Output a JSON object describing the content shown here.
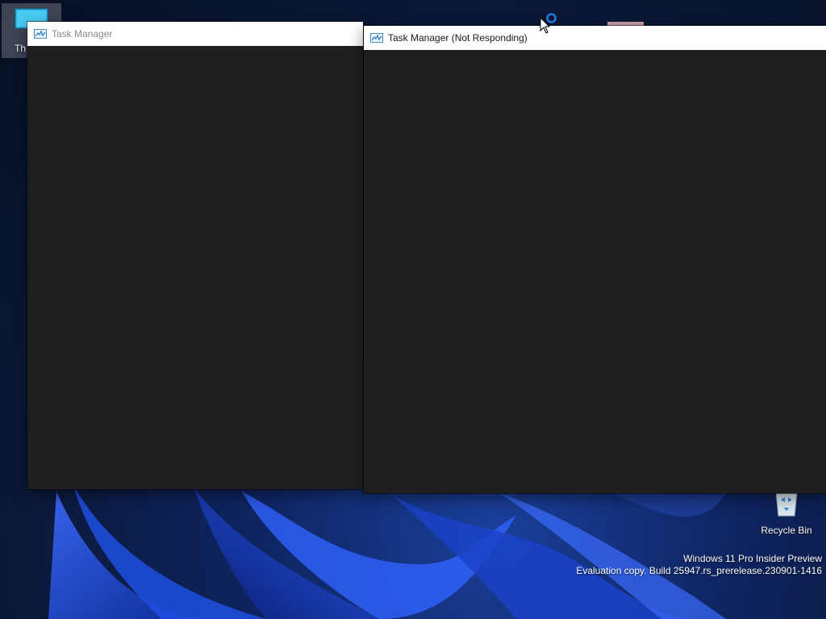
{
  "desktop": {
    "icons": [
      {
        "label": "Th",
        "icon": "this-pc-icon"
      },
      {
        "label": "Recycle Bin",
        "icon": "recycle-bin-icon"
      }
    ],
    "watermark": {
      "line1": "Windows 11 Pro Insider Preview",
      "line2": "Evaluation copy. Build 25947.rs_prerelease.230901-1416"
    }
  },
  "windows": [
    {
      "title": "Task Manager",
      "icon": "task-manager-icon",
      "state": "inactive"
    },
    {
      "title": "Task Manager (Not Responding)",
      "icon": "task-manager-icon",
      "state": "not-responding"
    }
  ],
  "cursor": {
    "type": "busy-pointer"
  },
  "colors": {
    "window_body": "#1f1f1f",
    "titlebar": "#ffffff",
    "inactive_title_text": "#8a8a8a",
    "active_title_text": "#1a1a1a",
    "busy_ring": "#1e7ad8"
  }
}
